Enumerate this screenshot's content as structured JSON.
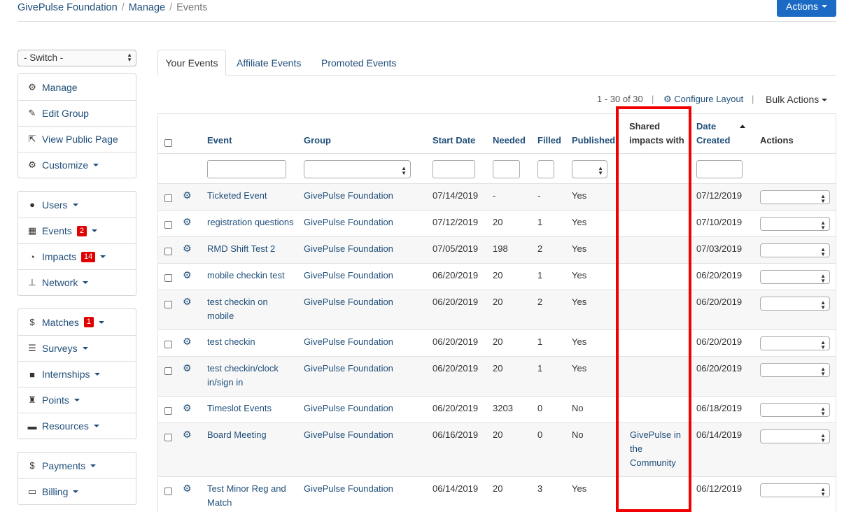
{
  "breadcrumb": {
    "org": "GivePulse Foundation",
    "manage": "Manage",
    "current": "Events",
    "separator": "/"
  },
  "actions_button": "Actions",
  "sidebar": {
    "switch_label": "- Switch -",
    "group1": [
      {
        "label": "Manage",
        "icon": "gears-icon"
      },
      {
        "label": "Edit Group",
        "icon": "pencil-icon"
      },
      {
        "label": "View Public Page",
        "icon": "external-link-icon"
      },
      {
        "label": "Customize",
        "icon": "gears-icon"
      }
    ],
    "group2": [
      {
        "label": "Users",
        "icon": "user-icon"
      },
      {
        "label": "Events",
        "icon": "calendar-icon",
        "badge": "2"
      },
      {
        "label": "Impacts",
        "icon": "dashboard-icon",
        "badge": "14"
      },
      {
        "label": "Network",
        "icon": "sitemap-icon"
      }
    ],
    "group3": [
      {
        "label": "Matches",
        "icon": "dollar-icon",
        "badge": "1"
      },
      {
        "label": "Surveys",
        "icon": "list-icon"
      },
      {
        "label": "Internships",
        "icon": "briefcase-icon"
      },
      {
        "label": "Points",
        "icon": "trophy-icon"
      },
      {
        "label": "Resources",
        "icon": "folder-icon"
      }
    ],
    "group4": [
      {
        "label": "Payments",
        "icon": "dollar-icon"
      },
      {
        "label": "Billing",
        "icon": "credit-card-icon"
      }
    ]
  },
  "tabs": [
    "Your Events",
    "Affiliate Events",
    "Promoted Events"
  ],
  "toolbar": {
    "pager": "1 - 30 of 30",
    "separator": "|",
    "configure": "Configure Layout",
    "bulk": "Bulk Actions"
  },
  "table": {
    "headers": {
      "event": "Event",
      "group": "Group",
      "start": "Start Date",
      "needed": "Needed",
      "filled": "Filled",
      "published": "Published",
      "shared_1": "Shared",
      "shared_2": "impacts with",
      "created_1": "Date",
      "created_2": "Created",
      "actions": "Actions"
    },
    "rows": [
      {
        "event": [
          "Ticketed Event"
        ],
        "group": "GivePulse Foundation",
        "start": "07/14/2019",
        "needed": "-",
        "filled": "-",
        "published": "Yes",
        "shared": [],
        "created": "07/12/2019"
      },
      {
        "event": [
          "registration questions"
        ],
        "group": "GivePulse Foundation",
        "start": "07/12/2019",
        "needed": "20",
        "filled": "1",
        "published": "Yes",
        "shared": [],
        "created": "07/10/2019"
      },
      {
        "event": [
          "RMD Shift Test 2"
        ],
        "group": "GivePulse Foundation",
        "start": "07/05/2019",
        "needed": "198",
        "filled": "2",
        "published": "Yes",
        "shared": [],
        "created": "07/03/2019"
      },
      {
        "event": [
          "mobile checkin test"
        ],
        "group": "GivePulse Foundation",
        "start": "06/20/2019",
        "needed": "20",
        "filled": "1",
        "published": "Yes",
        "shared": [],
        "created": "06/20/2019"
      },
      {
        "event": [
          "test checkin on",
          "mobile"
        ],
        "group": "GivePulse Foundation",
        "start": "06/20/2019",
        "needed": "20",
        "filled": "2",
        "published": "Yes",
        "shared": [],
        "created": "06/20/2019"
      },
      {
        "event": [
          "test checkin"
        ],
        "group": "GivePulse Foundation",
        "start": "06/20/2019",
        "needed": "20",
        "filled": "1",
        "published": "Yes",
        "shared": [],
        "created": "06/20/2019"
      },
      {
        "event": [
          "test checkin/clock",
          "in/sign in"
        ],
        "group": "GivePulse Foundation",
        "start": "06/20/2019",
        "needed": "20",
        "filled": "1",
        "published": "Yes",
        "shared": [],
        "created": "06/20/2019"
      },
      {
        "event": [
          "Timeslot Events"
        ],
        "group": "GivePulse Foundation",
        "start": "06/20/2019",
        "needed": "3203",
        "filled": "0",
        "published": "No",
        "shared": [],
        "created": "06/18/2019"
      },
      {
        "event": [
          "Board Meeting"
        ],
        "group": "GivePulse Foundation",
        "start": "06/16/2019",
        "needed": "20",
        "filled": "0",
        "published": "No",
        "shared": [
          "GivePulse in",
          "the",
          "Community"
        ],
        "created": "06/14/2019"
      },
      {
        "event": [
          "Test Minor Reg and",
          "Match"
        ],
        "group": "GivePulse Foundation",
        "start": "06/14/2019",
        "needed": "20",
        "filled": "3",
        "published": "Yes",
        "shared": [],
        "created": "06/12/2019"
      }
    ]
  },
  "colors": {
    "link": "#1f4e79",
    "primary": "#1b6ac4",
    "badge": "#e00000",
    "highlight": "#f00000"
  }
}
